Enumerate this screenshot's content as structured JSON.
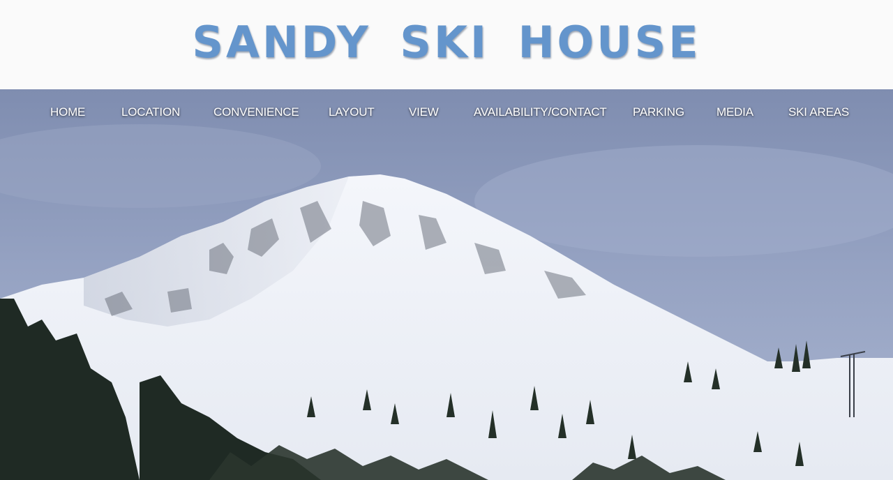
{
  "header": {
    "title": "SANDY SKI HOUSE"
  },
  "nav": {
    "items": [
      {
        "label": "HOME"
      },
      {
        "label": "LOCATION"
      },
      {
        "label": "CONVENIENCE"
      },
      {
        "label": "LAYOUT"
      },
      {
        "label": "VIEW"
      },
      {
        "label": "AVAILABILITY/CONTACT"
      },
      {
        "label": "PARKING"
      },
      {
        "label": "MEDIA"
      },
      {
        "label": "SKI AREAS"
      }
    ]
  },
  "colors": {
    "title": "#6495cc",
    "header_bg": "#fafafa",
    "sky": "#8e9cbe",
    "nav_text": "#ffffff"
  }
}
